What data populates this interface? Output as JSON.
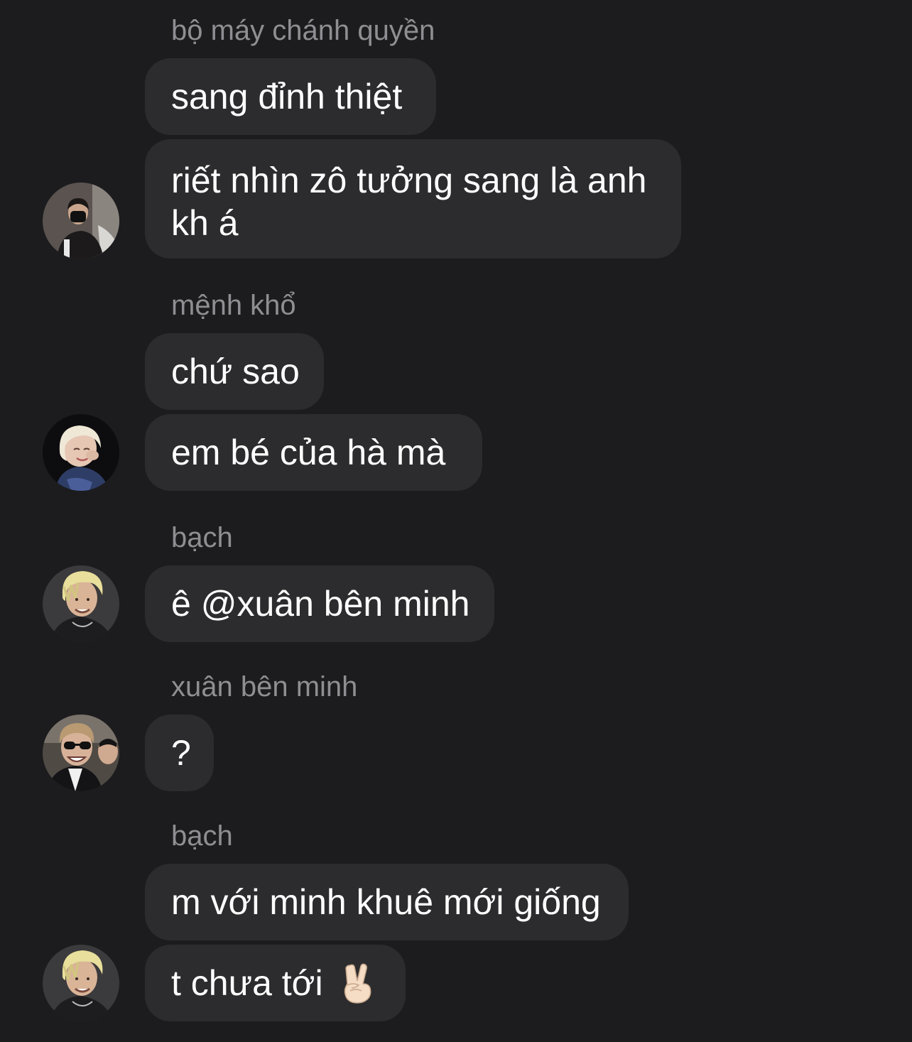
{
  "messages": [
    {
      "sender": "bộ máy chánh quyền",
      "avatar": "avatar-black-cap-mask",
      "bubbles": [
        "sang đỉnh thiệt",
        "riết nhìn zô tưởng sang là anh kh á"
      ]
    },
    {
      "sender": "mệnh khổ",
      "avatar": "avatar-blonde-woman",
      "bubbles": [
        "chứ sao",
        "em bé của hà mà"
      ]
    },
    {
      "sender": "bạch",
      "avatar": "avatar-blond-man",
      "bubbles": [
        "ê @xuân bên minh"
      ]
    },
    {
      "sender": "xuân bên minh",
      "avatar": "avatar-man-sunglasses",
      "bubbles": [
        "?"
      ]
    },
    {
      "sender": "bạch",
      "avatar": "avatar-blond-man",
      "bubbles": [
        "m với minh khuê mới giống",
        "t chưa tới"
      ],
      "emoji": "victory-hand-emoji"
    }
  ],
  "colors": {
    "background": "#1c1c1e",
    "bubble": "#2c2c2e",
    "sender_name": "#8e8e93",
    "text": "#ffffff"
  }
}
